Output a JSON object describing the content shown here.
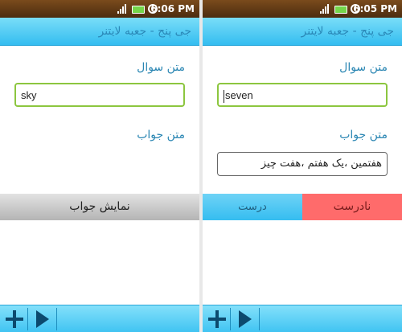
{
  "screens": [
    {
      "status": {
        "time": "6:06 PM"
      },
      "title": "جی پنج - جعبه لایتنر",
      "question_label": "متن سوال",
      "question_value": "sky",
      "answer_label": "متن جواب",
      "show_answer_label": "نمایش جواب"
    },
    {
      "status": {
        "time": "6:05 PM"
      },
      "title": "جی پنج - جعبه لایتنر",
      "question_label": "متن سوال",
      "question_value": "seven",
      "answer_label": "متن جواب",
      "answer_value": "هفتمین ،یک هفتم ،هفت چیز",
      "correct_label": "درست",
      "wrong_label": "نادرست"
    }
  ],
  "icons": {
    "add": "plus-icon",
    "play": "play-icon",
    "signal": "signal-icon",
    "battery": "battery-icon",
    "alarm": "alarm-icon"
  },
  "colors": {
    "accent": "#34bdf0",
    "label": "#2a86b3",
    "focus": "#8cc63f",
    "wrong": "#ff6b6b"
  }
}
